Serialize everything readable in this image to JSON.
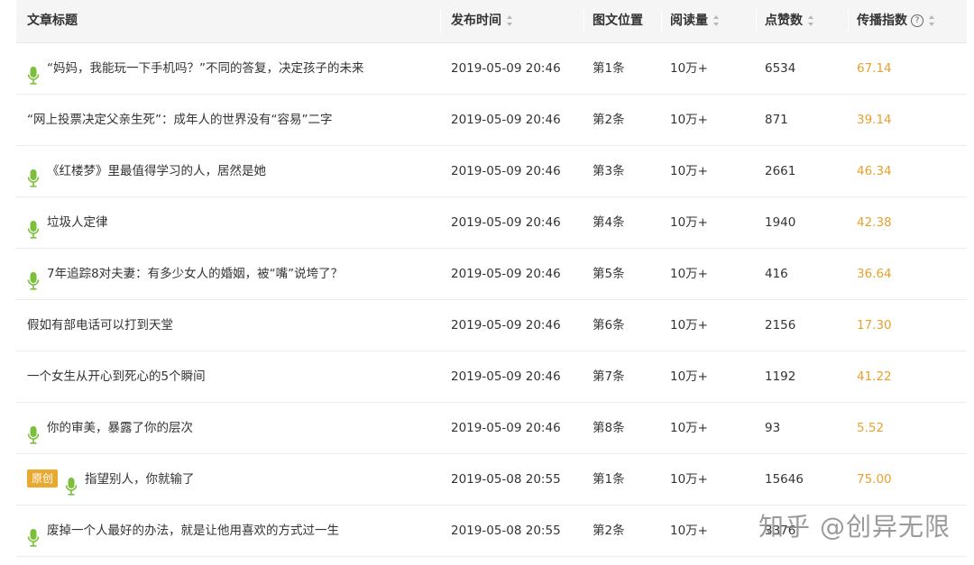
{
  "header": {
    "title": "文章标题",
    "time": "发布时间",
    "position": "图文位置",
    "reads": "阅读量",
    "likes": "点赞数",
    "index": "传播指数",
    "help_glyph": "?"
  },
  "rows": [
    {
      "title": "“妈妈，我能玩一下手机吗？”不同的答复，决定孩子的未来",
      "mic": true,
      "original": false,
      "time": "2019-05-09 20:46",
      "position": "第1条",
      "reads": "10万+",
      "likes": "6534",
      "index": "67.14"
    },
    {
      "title": "“网上投票决定父亲生死”：成年人的世界没有“容易”二字",
      "mic": false,
      "original": false,
      "time": "2019-05-09 20:46",
      "position": "第2条",
      "reads": "10万+",
      "likes": "871",
      "index": "39.14"
    },
    {
      "title": "《红楼梦》里最值得学习的人，居然是她",
      "mic": true,
      "original": false,
      "time": "2019-05-09 20:46",
      "position": "第3条",
      "reads": "10万+",
      "likes": "2661",
      "index": "46.34"
    },
    {
      "title": "垃圾人定律",
      "mic": true,
      "original": false,
      "time": "2019-05-09 20:46",
      "position": "第4条",
      "reads": "10万+",
      "likes": "1940",
      "index": "42.38"
    },
    {
      "title": "7年追踪8对夫妻：有多少女人的婚姻，被“嘴”说垮了？",
      "mic": true,
      "original": false,
      "time": "2019-05-09 20:46",
      "position": "第5条",
      "reads": "10万+",
      "likes": "416",
      "index": "36.64"
    },
    {
      "title": "假如有部电话可以打到天堂",
      "mic": false,
      "original": false,
      "time": "2019-05-09 20:46",
      "position": "第6条",
      "reads": "10万+",
      "likes": "2156",
      "index": "17.30"
    },
    {
      "title": "一个女生从开心到死心的5个瞬间",
      "mic": false,
      "original": false,
      "time": "2019-05-09 20:46",
      "position": "第7条",
      "reads": "10万+",
      "likes": "1192",
      "index": "41.22"
    },
    {
      "title": "你的审美，暴露了你的层次",
      "mic": true,
      "original": false,
      "time": "2019-05-09 20:46",
      "position": "第8条",
      "reads": "10万+",
      "likes": "93",
      "index": "5.52"
    },
    {
      "title": "指望别人，你就输了",
      "mic": true,
      "original": true,
      "original_label": "原创",
      "time": "2019-05-08 20:55",
      "position": "第1条",
      "reads": "10万+",
      "likes": "15646",
      "index": "75.00"
    },
    {
      "title": "废掉一个人最好的办法，就是让他用喜欢的方式过一生",
      "mic": true,
      "original": false,
      "time": "2019-05-08 20:55",
      "position": "第2条",
      "reads": "10万+",
      "likes": "3376",
      "index": ""
    }
  ],
  "watermark": "知乎 @创异无限",
  "colors": {
    "header_bg": "#f5f5f5",
    "index_orange": "#e8a02e",
    "mic_green": "#7bbf3a",
    "badge_orange": "#e8a930"
  }
}
